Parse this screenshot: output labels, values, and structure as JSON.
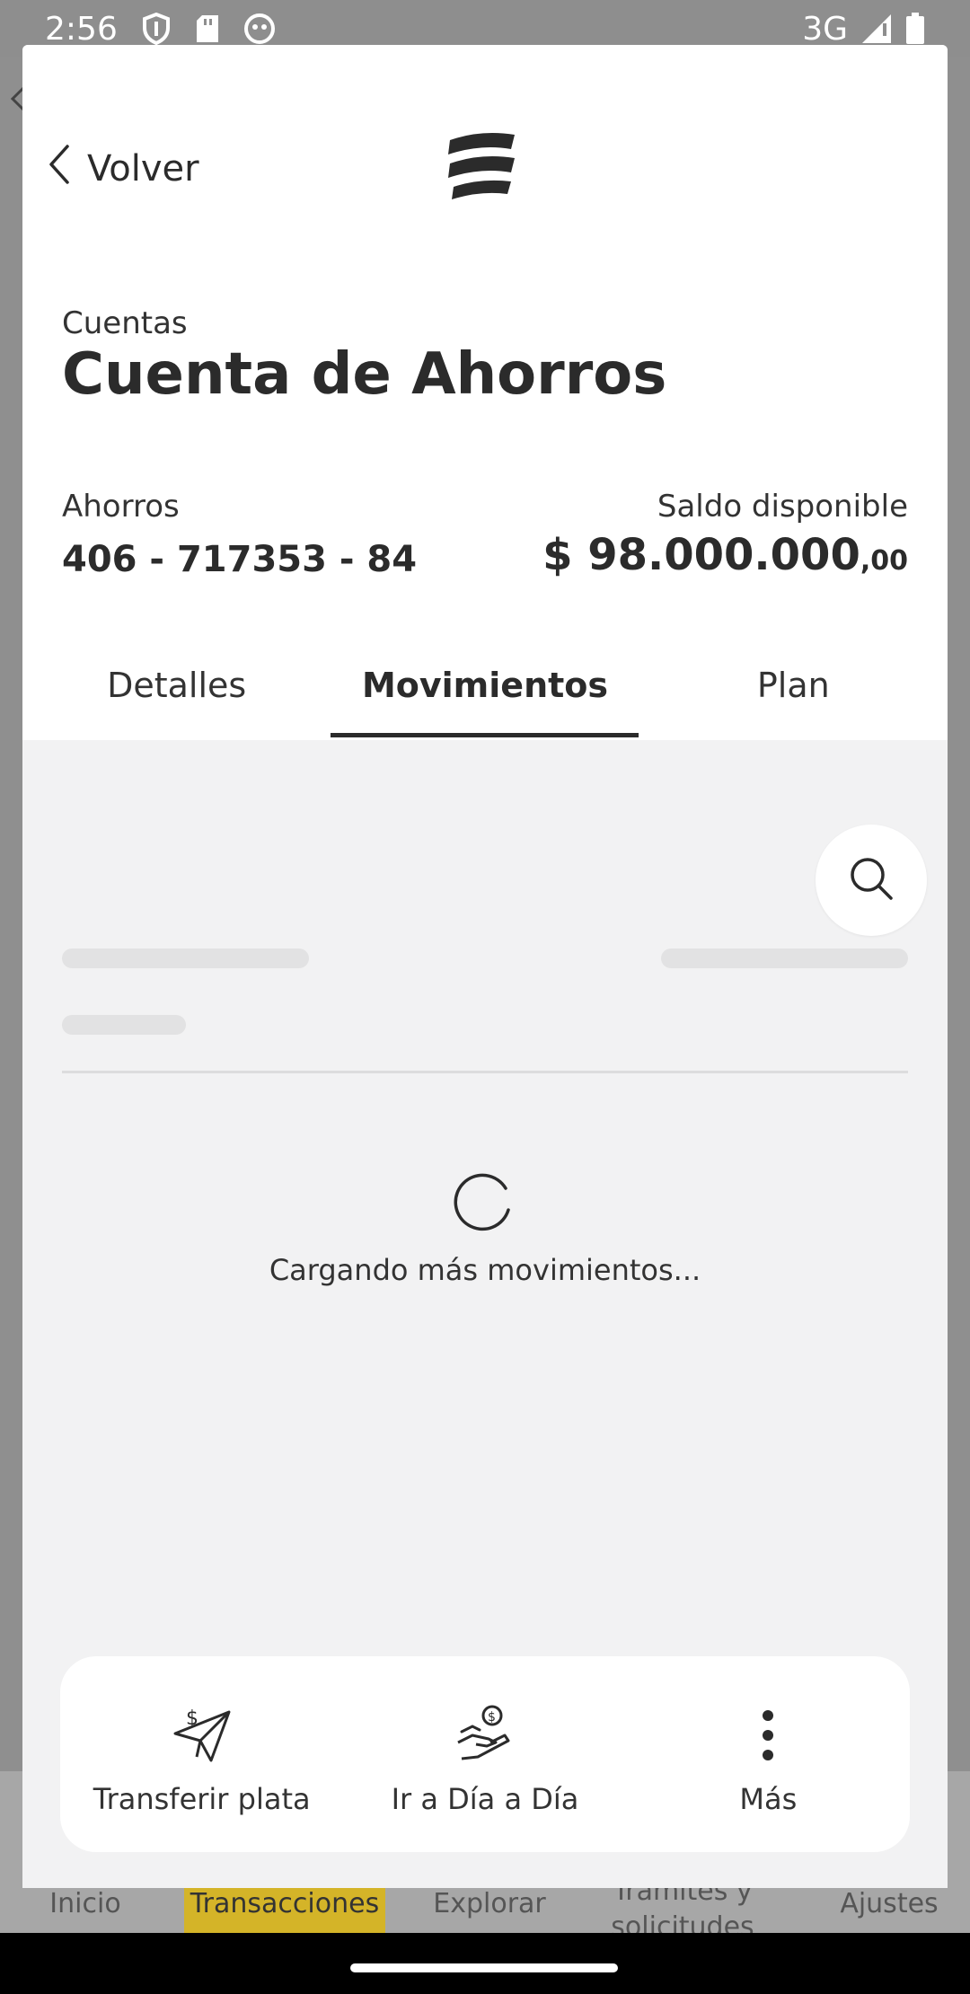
{
  "status_bar": {
    "time": "2:56",
    "network": "3G",
    "icons": [
      "shield-icon",
      "sd-card-icon",
      "face-icon",
      "signal-icon",
      "battery-icon"
    ]
  },
  "background_nav": {
    "items": [
      "Inicio",
      "Transacciones",
      "Explorar",
      "Trámites y solicitudes",
      "Ajustes"
    ],
    "active_color": "#d4b428"
  },
  "header": {
    "back_label": "Volver",
    "logo": "bancolombia-logo"
  },
  "account": {
    "breadcrumb": "Cuentas",
    "title": "Cuenta de Ahorros",
    "type": "Ahorros",
    "number": "406 - 717353 - 84",
    "balance_label": "Saldo disponible",
    "balance_main": "$ 98.000.000",
    "balance_cents": ",00"
  },
  "tabs": [
    {
      "label": "Detalles",
      "active": false
    },
    {
      "label": "Movimientos",
      "active": true
    },
    {
      "label": "Plan",
      "active": false
    }
  ],
  "movements": {
    "loading_text": "Cargando más movimientos..."
  },
  "actions": [
    {
      "label": "Transferir plata",
      "icon": "send-money-icon"
    },
    {
      "label": "Ir a Día a Día",
      "icon": "hand-money-icon"
    },
    {
      "label": "Más",
      "icon": "more-vertical-icon"
    }
  ]
}
